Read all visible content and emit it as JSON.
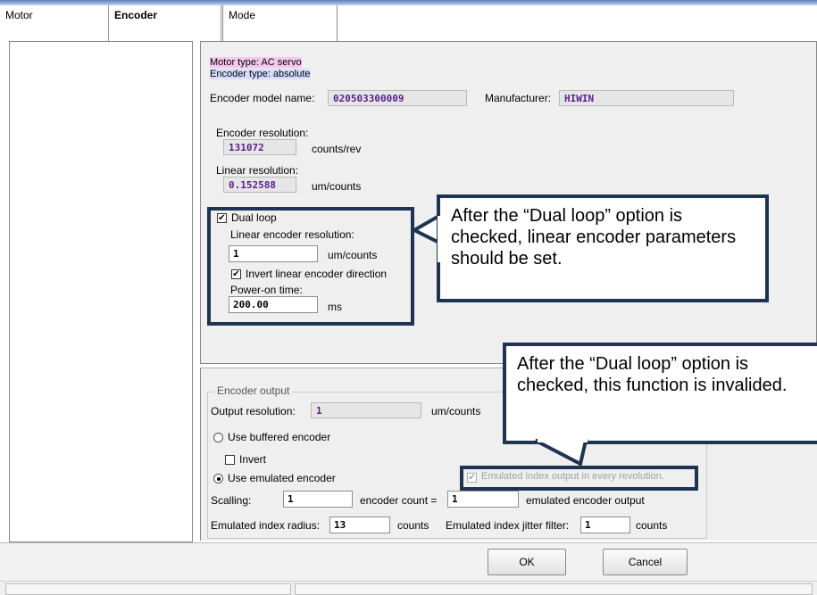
{
  "tabs": [
    {
      "label": "Motor"
    },
    {
      "label": "Encoder"
    },
    {
      "label": "Mode"
    }
  ],
  "info": {
    "motor_type": "Motor type: AC servo",
    "encoder_type": "Encoder type: absolute"
  },
  "encoder_model": {
    "label": "Encoder model name:",
    "value": "020503300009",
    "manufacturer_label": "Manufacturer:",
    "manufacturer_value": "HIWIN"
  },
  "encoder_resolution": {
    "label": "Encoder resolution:",
    "value": "131072",
    "unit": "counts/rev"
  },
  "linear_resolution": {
    "label": "Linear resolution:",
    "value": "0.152588",
    "unit": "um/counts"
  },
  "dual_loop": {
    "checkbox_label": "Dual loop",
    "checked": true,
    "linear_encoder_resolution_label": "Linear encoder resolution:",
    "linear_encoder_resolution_value": "1",
    "linear_encoder_resolution_unit": "um/counts",
    "invert_label": "Invert linear encoder direction",
    "invert_checked": true,
    "power_on_label": "Power-on time:",
    "power_on_value": "200.00",
    "power_on_unit": "ms"
  },
  "encoder_output": {
    "group_label": "Encoder output",
    "output_resolution_label": "Output resolution:",
    "output_resolution_value": "1",
    "output_resolution_unit": "um/counts",
    "use_buffered_label": "Use buffered encoder",
    "invert_label": "Invert",
    "use_emulated_label": "Use emulated encoder",
    "emulated_index_label": "Emulated index output in every revolution.",
    "scalling_label": "Scalling:",
    "scalling_value": "1",
    "encoder_count_label": "encoder count =",
    "encoder_count_value": "1",
    "emulated_output_label": "emulated encoder output",
    "index_radius_label": "Emulated index radius:",
    "index_radius_value": "13",
    "index_radius_unit": "counts",
    "jitter_label": "Emulated index jitter filter:",
    "jitter_value": "1",
    "jitter_unit": "counts"
  },
  "callouts": {
    "first": "After the “Dual loop” option is checked, linear encoder parameters should be set.",
    "second": "After the “Dual loop” option is checked, this function is invalided."
  },
  "buttons": {
    "ok": "OK",
    "cancel": "Cancel"
  },
  "colors": {
    "callout_border": "#1f3353",
    "value_text": "#5a1e8c"
  }
}
